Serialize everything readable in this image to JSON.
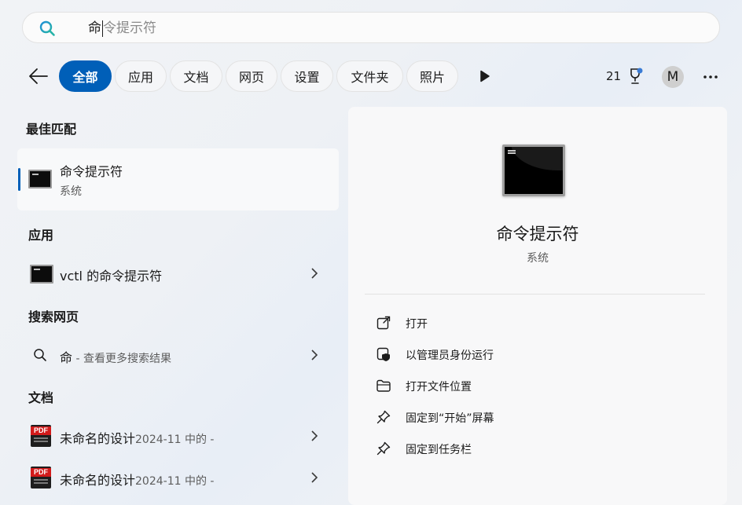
{
  "search": {
    "typed": "命",
    "hint": "令提示符"
  },
  "filters": {
    "chips": [
      "全部",
      "应用",
      "文档",
      "网页",
      "设置",
      "文件夹",
      "照片"
    ],
    "active": "全部"
  },
  "account": {
    "points": "21",
    "avatar_initial": "M"
  },
  "left": {
    "best_match": {
      "heading": "最佳匹配",
      "title": "命令提示符",
      "subtitle": "系统"
    },
    "apps": {
      "heading": "应用",
      "items": [
        {
          "label": "vctl 的命令提示符"
        }
      ]
    },
    "web": {
      "heading": "搜索网页",
      "query": "命",
      "suffix": " - 查看更多搜索结果"
    },
    "docs": {
      "heading": "文档",
      "items": [
        {
          "name": "未命名的设计",
          "meta": "2024-11 中的 -",
          "icon_tag": "PDF"
        },
        {
          "name": "未命名的设计",
          "meta": "2024-11 中的 -",
          "icon_tag": "PDF"
        }
      ]
    }
  },
  "detail": {
    "title": "命令提示符",
    "type": "系统",
    "actions": [
      {
        "label": "打开",
        "icon": "open-external-icon"
      },
      {
        "label": "以管理员身份运行",
        "icon": "shield-admin-icon"
      },
      {
        "label": "打开文件位置",
        "icon": "folder-icon"
      },
      {
        "label": "固定到“开始”屏幕",
        "icon": "pin-icon"
      },
      {
        "label": "固定到任务栏",
        "icon": "pin-icon"
      }
    ]
  },
  "colors": {
    "accent": "#005fb8"
  }
}
